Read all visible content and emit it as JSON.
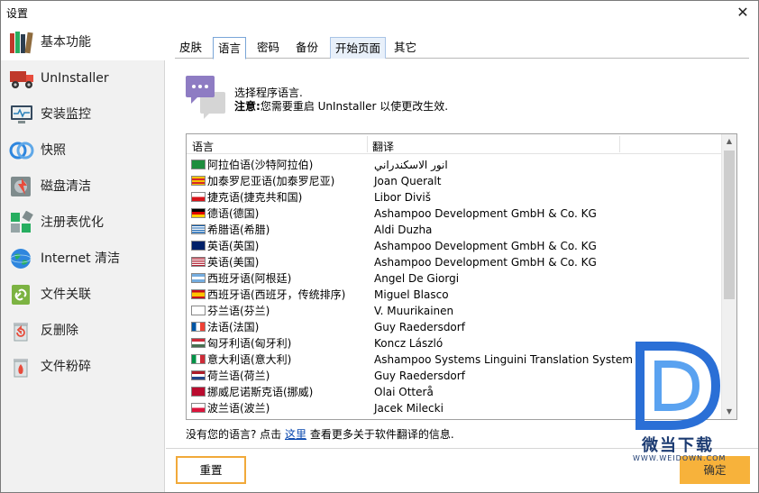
{
  "window": {
    "title": "设置",
    "close": "✕"
  },
  "sidebar": {
    "items": [
      {
        "label": "基本功能",
        "icon": "books-icon",
        "active": true
      },
      {
        "label": "UnInstaller",
        "icon": "uninstaller-truck-icon"
      },
      {
        "label": "安装监控",
        "icon": "monitor-icon"
      },
      {
        "label": "快照",
        "icon": "snapshot-rings-icon"
      },
      {
        "label": "磁盘清洁",
        "icon": "disk-cleaner-icon"
      },
      {
        "label": "注册表优化",
        "icon": "registry-blocks-icon"
      },
      {
        "label": "Internet 清洁",
        "icon": "globe-icon"
      },
      {
        "label": "文件关联",
        "icon": "file-link-icon"
      },
      {
        "label": "反删除",
        "icon": "undelete-bin-icon"
      },
      {
        "label": "文件粉碎",
        "icon": "shredder-bin-icon"
      }
    ]
  },
  "tabs": [
    {
      "label": "皮肤"
    },
    {
      "label": "语言",
      "active": true
    },
    {
      "label": "密码"
    },
    {
      "label": "备份"
    },
    {
      "label": "开始页面",
      "hover": true
    },
    {
      "label": "其它"
    }
  ],
  "language": {
    "prompt": "选择程序语言.",
    "note_bold": "注意:",
    "note_text": "您需要重启 UnInstaller 以使更改生效.",
    "columns": {
      "lang": "语言",
      "translator": "翻译"
    },
    "rows": [
      {
        "lang": "阿拉伯语(沙特阿拉伯)",
        "translator": "انور الاسكندراني",
        "flag": "sa"
      },
      {
        "lang": "加泰罗尼亚语(加泰罗尼亚)",
        "translator": "Joan Queralt",
        "flag": "ca"
      },
      {
        "lang": "捷克语(捷克共和国)",
        "translator": "Libor Diviš",
        "flag": "cz"
      },
      {
        "lang": "德语(德国)",
        "translator": "Ashampoo Development GmbH & Co. KG",
        "flag": "de"
      },
      {
        "lang": "希腊语(希腊)",
        "translator": "Aldi Duzha",
        "flag": "gr"
      },
      {
        "lang": "英语(英国)",
        "translator": "Ashampoo Development GmbH & Co. KG",
        "flag": "gb"
      },
      {
        "lang": "英语(美国)",
        "translator": "Ashampoo Development GmbH & Co. KG",
        "flag": "us"
      },
      {
        "lang": "西班牙语(阿根廷)",
        "translator": "Angel De Giorgi",
        "flag": "ar"
      },
      {
        "lang": "西班牙语(西班牙，传统排序)",
        "translator": "Miguel Blasco",
        "flag": "es"
      },
      {
        "lang": "芬兰语(芬兰)",
        "translator": "V. Muurikainen",
        "flag": "fi"
      },
      {
        "lang": "法语(法国)",
        "translator": "Guy Raedersdorf",
        "flag": "fr"
      },
      {
        "lang": "匈牙利语(匈牙利)",
        "translator": "Koncz László",
        "flag": "hu"
      },
      {
        "lang": "意大利语(意大利)",
        "translator": "Ashampoo Systems Linguini Translation System",
        "flag": "it"
      },
      {
        "lang": "荷兰语(荷兰)",
        "translator": "Guy Raedersdorf",
        "flag": "nl"
      },
      {
        "lang": "挪威尼诺斯克语(挪威)",
        "translator": "Olai Otterå",
        "flag": "no"
      },
      {
        "lang": "波兰语(波兰)",
        "translator": "Jacek Milecki",
        "flag": "pl"
      }
    ],
    "info_before": "没有您的语言? 点击 ",
    "info_link": "这里",
    "info_after": " 查看更多关于软件翻译的信息."
  },
  "buttons": {
    "reset": "重置",
    "ok": "确定"
  },
  "watermark": {
    "text": "微当下载",
    "url": "WWW.WEIDOWN.COM"
  }
}
